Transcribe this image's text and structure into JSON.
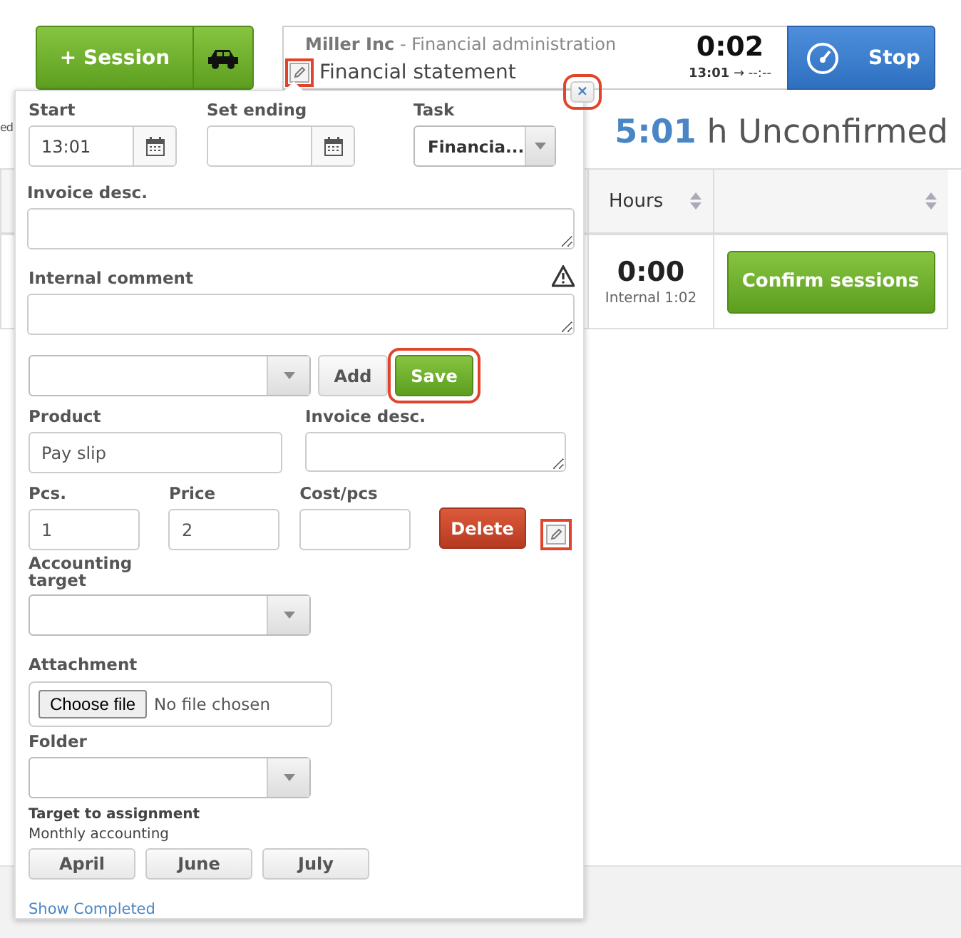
{
  "session_button": {
    "label": "+ Session"
  },
  "timer": {
    "customer": "Miller Inc",
    "project": "- Financial administration",
    "task": "Financial statement",
    "edit_highlighted": true,
    "elapsed": "0:02",
    "start": "13:01",
    "arrow": "→",
    "end": "--:--"
  },
  "stop_button": {
    "label": "Stop"
  },
  "close_button": {
    "label": "×",
    "highlighted": true
  },
  "cut_text": "ed",
  "summary": {
    "hours": "5:01",
    "unit": "h Unconfirmed"
  },
  "table": {
    "columns": [
      {
        "label": "Hours",
        "sortable": true
      },
      {
        "sortable": true
      }
    ],
    "row": {
      "hours": "0:00",
      "internal": "Internal 1:02",
      "action": "Confirm sessions"
    }
  },
  "popup": {
    "start": {
      "label": "Start",
      "value": "13:01"
    },
    "set_ending": {
      "label": "Set ending"
    },
    "task": {
      "label": "Task",
      "value": "Financia..."
    },
    "invoice_desc": {
      "label": "Invoice desc."
    },
    "internal_comment": {
      "label": "Internal comment"
    },
    "product_actions": [
      {
        "label": "Add",
        "kind": "plain",
        "highlighted": false
      },
      {
        "label": "Save",
        "kind": "primary",
        "highlighted": true
      }
    ],
    "product": {
      "label": "Product",
      "value": "Pay slip"
    },
    "product_invoice_desc": {
      "label": "Invoice desc."
    },
    "pcs": {
      "label": "Pcs.",
      "value": "1"
    },
    "price": {
      "label": "Price",
      "value": "2"
    },
    "cost": {
      "label": "Cost/pcs"
    },
    "delete_button": {
      "label": "Delete"
    },
    "row_edit": {
      "highlighted": true
    },
    "accounting_target": {
      "label": "Accounting target"
    },
    "attachment": {
      "label": "Attachment",
      "button": "Choose file",
      "status": "No file chosen"
    },
    "folder": {
      "label": "Folder"
    },
    "assignment": {
      "label": "Target to assignment",
      "name": "Monthly accounting",
      "months": [
        "April",
        "June",
        "July"
      ]
    },
    "show_completed": "Show Completed"
  }
}
